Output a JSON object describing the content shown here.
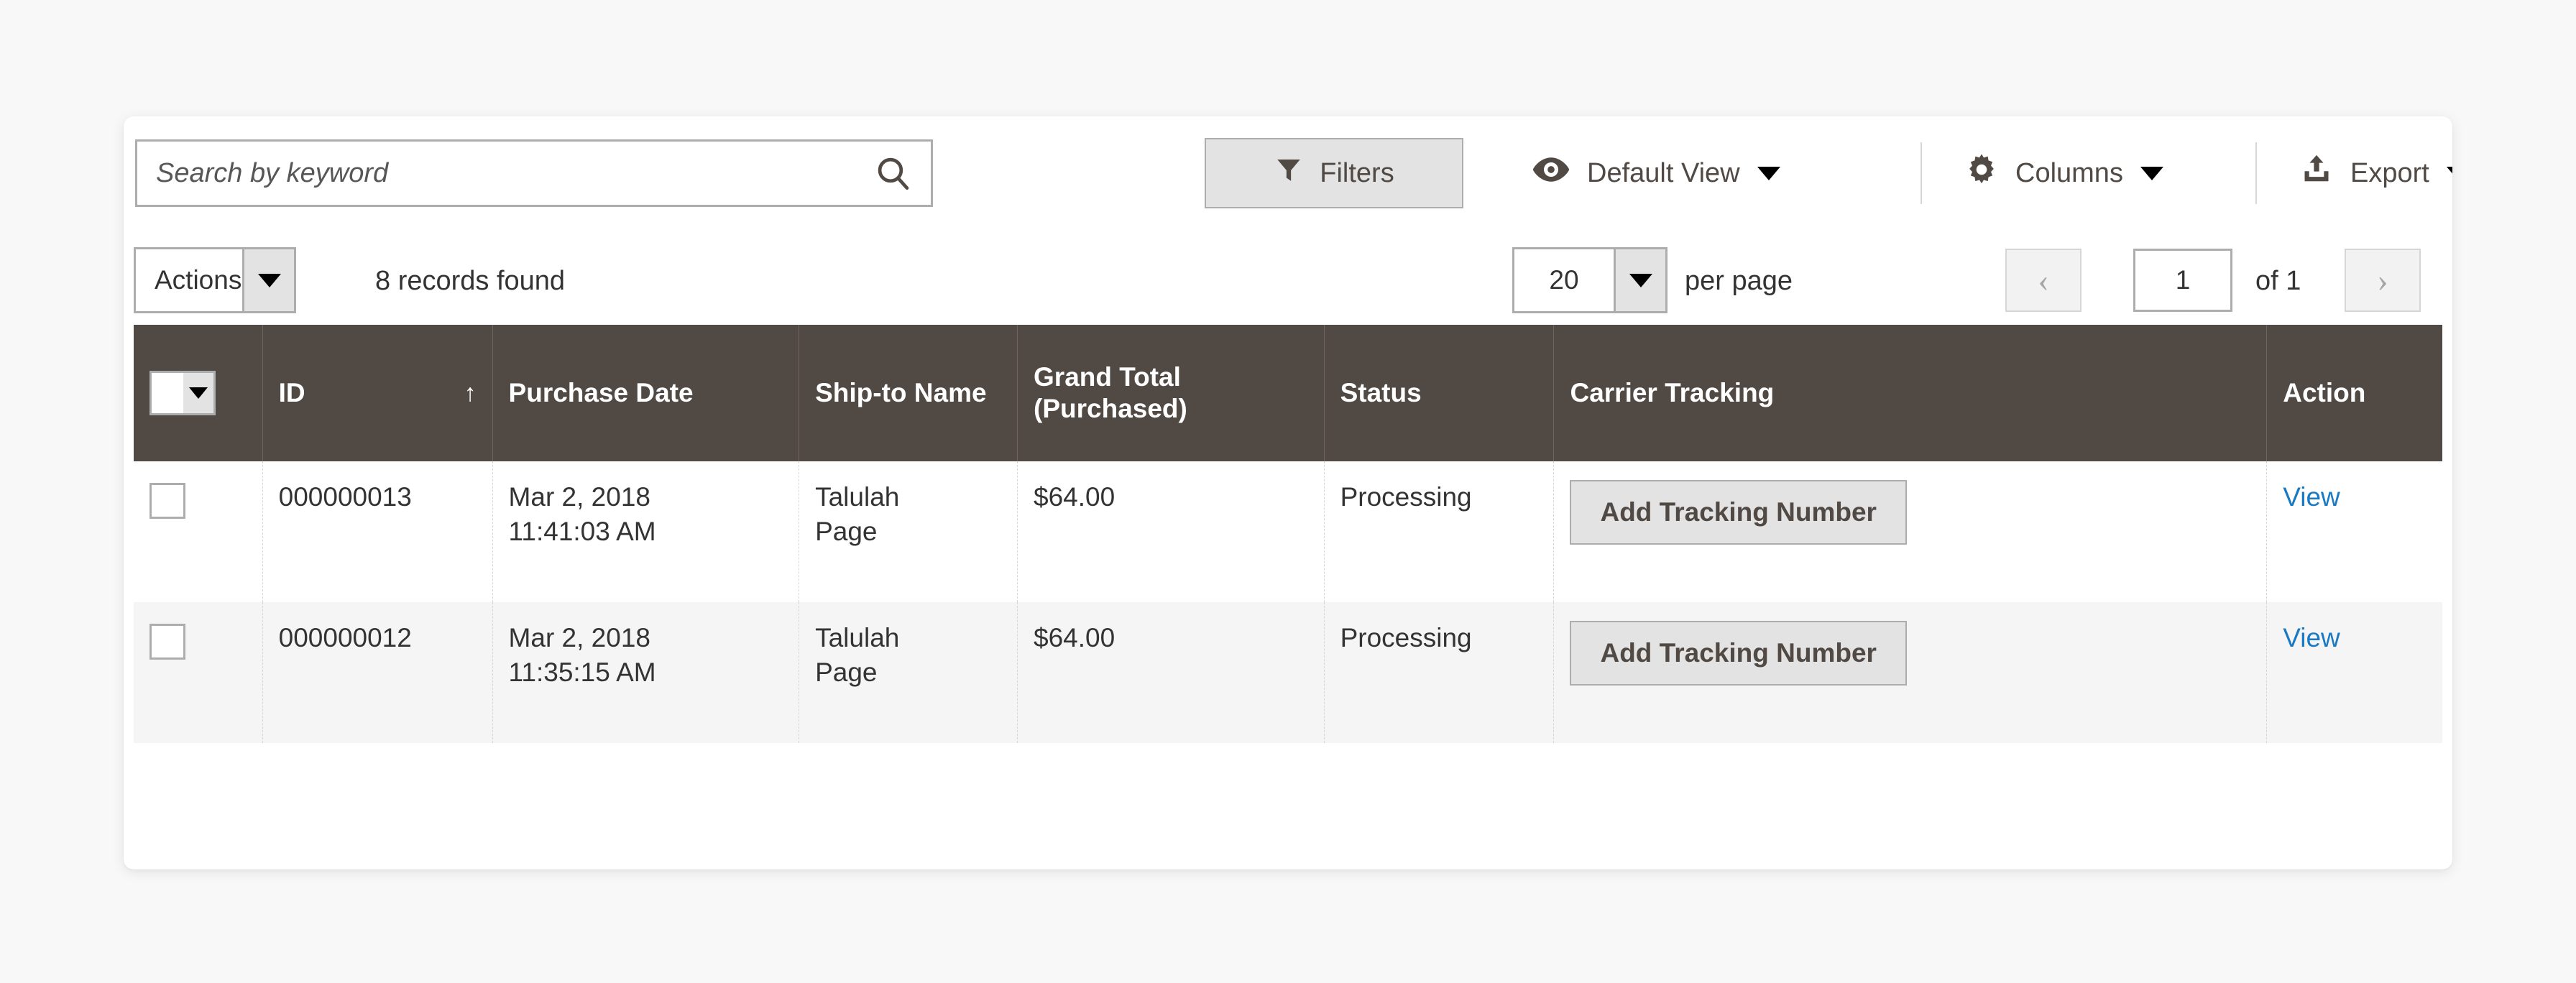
{
  "search": {
    "placeholder": "Search by keyword",
    "value": "",
    "icon": "search-icon"
  },
  "toolbar": {
    "filters_label": "Filters",
    "filters_icon": "filter-funnel-icon",
    "view_label": "Default View",
    "view_icon": "eye-icon",
    "columns_label": "Columns",
    "columns_icon": "gear-icon",
    "export_label": "Export",
    "export_icon": "upload-export-icon"
  },
  "subbar": {
    "actions_label": "Actions",
    "records_found": "8 records found",
    "per_page_value": "20",
    "per_page_label": "per page",
    "prev_icon": "chevron-left-icon",
    "next_icon": "chevron-right-icon",
    "page_value": "1",
    "of_label": "of 1"
  },
  "table": {
    "columns": [
      {
        "key": "checkbox",
        "label": ""
      },
      {
        "key": "id",
        "label": "ID",
        "sort": "↑"
      },
      {
        "key": "purchase_date",
        "label": "Purchase Date"
      },
      {
        "key": "ship_to_name",
        "label": "Ship-to Name"
      },
      {
        "key": "grand_total",
        "label": "Grand Total (Purchased)"
      },
      {
        "key": "status",
        "label": "Status"
      },
      {
        "key": "carrier_tracking",
        "label": "Carrier Tracking"
      },
      {
        "key": "action",
        "label": "Action"
      }
    ],
    "rows": [
      {
        "id": "000000013",
        "date_day": "Mar 2, 2018",
        "date_time": "11:41:03 AM",
        "ship_first": "Talulah",
        "ship_last": "Page",
        "grand_total": "$64.00",
        "status": "Processing",
        "tracking_button": "Add Tracking Number",
        "action": "View"
      },
      {
        "id": "000000012",
        "date_day": "Mar 2, 2018",
        "date_time": "11:35:15 AM",
        "ship_first": "Talulah",
        "ship_last": "Page",
        "grand_total": "$64.00",
        "status": "Processing",
        "tracking_button": "Add Tracking Number",
        "action": "View"
      }
    ]
  },
  "colors": {
    "header_bg": "#514943",
    "link": "#1979c3",
    "page_bg": "#f8f8f8",
    "button_bg": "#e3e3e3",
    "border": "#adadad",
    "row_alt_bg": "#f5f5f5"
  }
}
